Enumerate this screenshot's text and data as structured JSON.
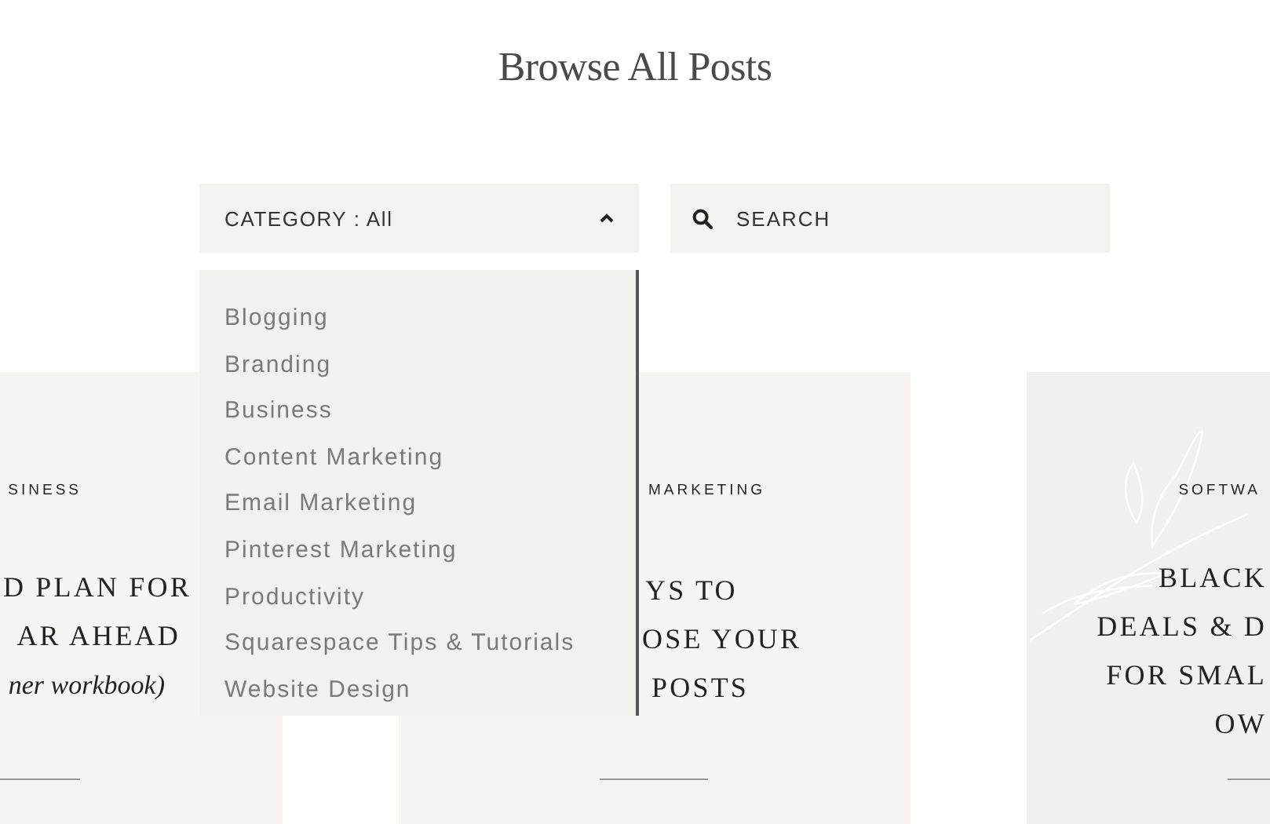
{
  "heading": "Browse All Posts",
  "category_filter": {
    "label": "CATEGORY : All",
    "expanded": true,
    "options": [
      "Blogging",
      "Branding",
      "Business",
      "Content Marketing",
      "Email Marketing",
      "Pinterest Marketing",
      "Productivity",
      "Squarespace Tips & Tutorials",
      "Website Design"
    ]
  },
  "search": {
    "placeholder": "SEARCH"
  },
  "posts": [
    {
      "category": "SINESS",
      "title_lines": [
        "D PLAN FOR",
        "AR AHEAD"
      ],
      "subtitle": "ner workbook)",
      "decorated": false
    },
    {
      "category": "MARKETING",
      "title_lines": [
        "YS TO",
        "OSE YOUR",
        "POSTS"
      ],
      "decorated": false
    },
    {
      "category": "SOFTWA",
      "title_lines": [
        "BLACK",
        "DEALS & D",
        "FOR SMAL",
        "OW"
      ],
      "decorated": true
    }
  ]
}
